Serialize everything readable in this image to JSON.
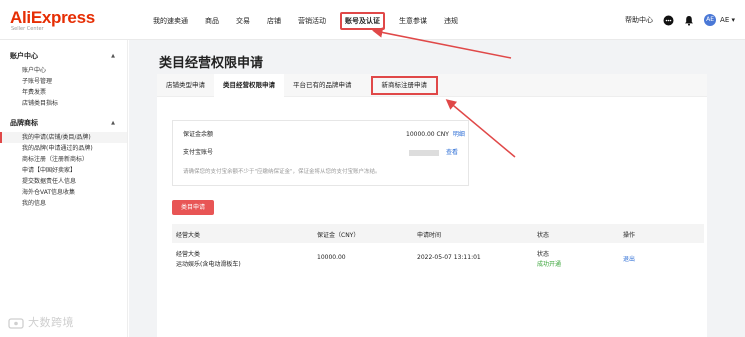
{
  "logo": {
    "main": "AliExpress",
    "sub": "Seller Center"
  },
  "nav": [
    {
      "label": "我的速卖通"
    },
    {
      "label": "商品"
    },
    {
      "label": "交易"
    },
    {
      "label": "店铺"
    },
    {
      "label": "营销活动"
    },
    {
      "label": "账号及认证"
    },
    {
      "label": "生意参谋"
    },
    {
      "label": "违规"
    }
  ],
  "top_right": {
    "help": "帮助中心",
    "avatar": "AE",
    "user": "AE ▾"
  },
  "sidebar": {
    "sections": [
      {
        "title": "账户中心",
        "items": [
          "账户中心",
          "子账号管理",
          "年费发票",
          "店铺类目指标"
        ]
      },
      {
        "title": "品牌商标",
        "items": [
          "我的申请(店铺/类目/品牌)",
          "我的品牌(申请通过的品牌)",
          "商标注册（注册新商标）",
          "申请【中国好卖家】",
          "提交数据责任人信息",
          "海外仓VAT信息收集",
          "我的信息"
        ]
      }
    ]
  },
  "page": {
    "title": "类目经营权限申请"
  },
  "tabs": [
    "店铺类型申请",
    "类目经营权限申请",
    "平台已有的品牌申请",
    "新商标注册申请"
  ],
  "info": {
    "deposit_label": "保证金余额",
    "deposit_value": "10000.00 CNY",
    "deposit_link": "明细",
    "alipay_label": "支付宝账号",
    "alipay_link": "查看",
    "note": "请确保您的支付宝余额不少于\"应缴纳保证金\"，保证金将从您的支付宝账户冻结。"
  },
  "cta": "类目申请",
  "table": {
    "headers": [
      "经营大类",
      "保证金（CNY）",
      "申请时间",
      "状态",
      "操作"
    ],
    "rows": [
      {
        "category_main": "经营大类",
        "category_sub": "运动娱乐(含电动滑板车)",
        "deposit": "10000.00",
        "time": "2022-05-07 13:11:01",
        "status_label": "状态",
        "status": "成功开通",
        "action": "退出"
      }
    ]
  },
  "watermark": "大数跨境",
  "colors": {
    "brand": "#e62e04",
    "accent_red": "#e04848",
    "link": "#2f6fd6",
    "success": "#3aa53a"
  }
}
